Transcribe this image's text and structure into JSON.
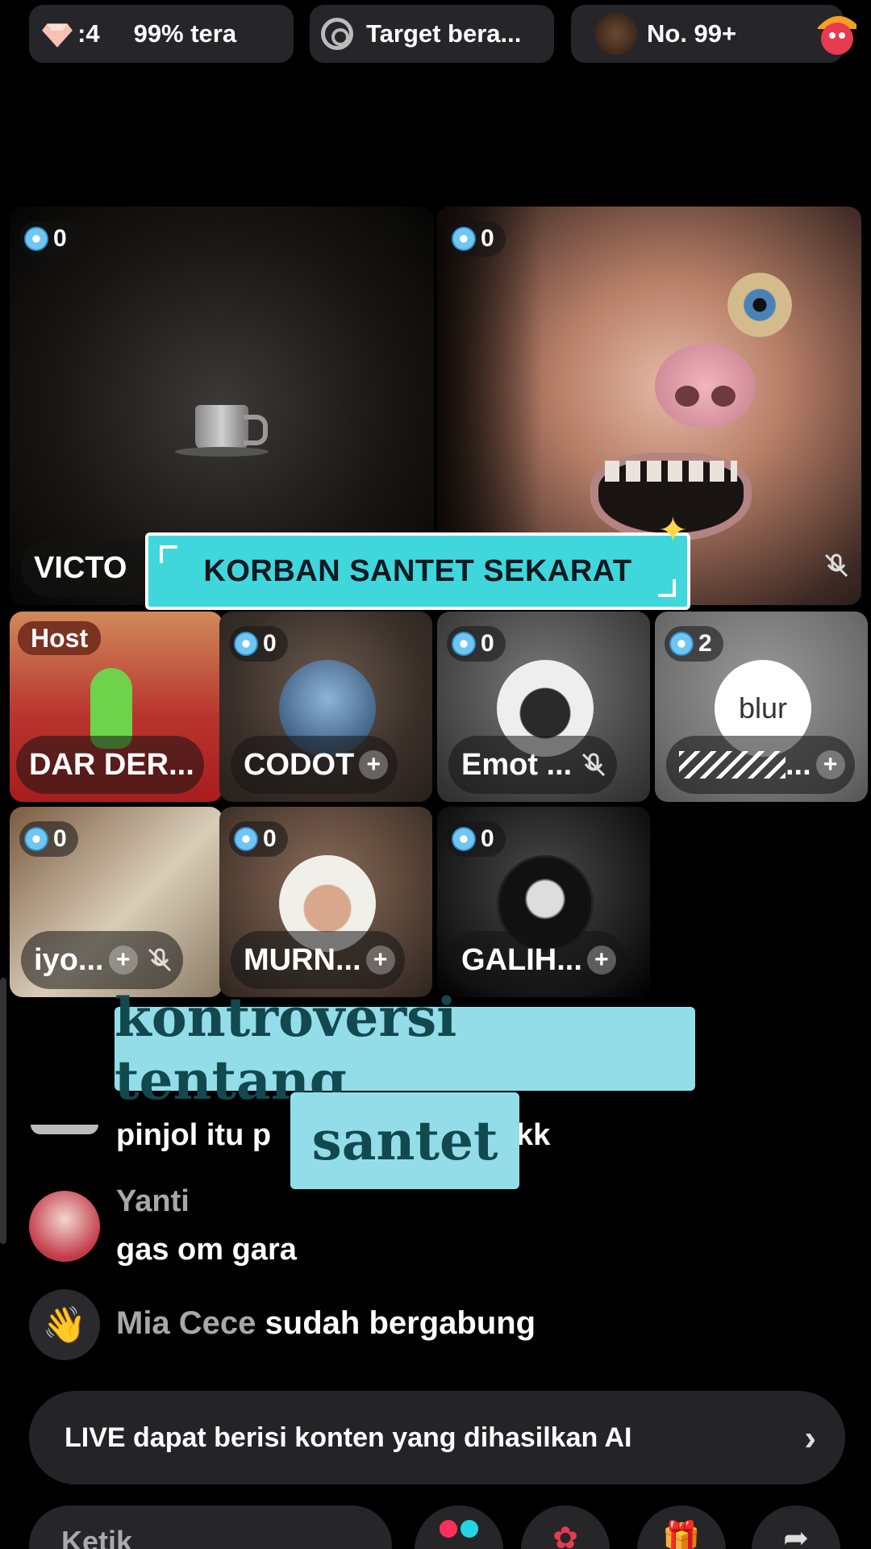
{
  "top_bar": {
    "gem_count": ":4",
    "rank_percent": "99% tera",
    "target": "Target bera...",
    "rank_number": "No. 99+"
  },
  "main_tiles": [
    {
      "gift_count": "0",
      "name": "VICTO"
    },
    {
      "gift_count": "0",
      "name": ""
    }
  ],
  "caption_banner": "KORBAN SANTET SEKARAT",
  "guest_tiles": [
    {
      "tag": "Host",
      "name": "DAR DER..."
    },
    {
      "gift_count": "0",
      "name": "CODOT"
    },
    {
      "gift_count": "0",
      "name": "Emot ..."
    },
    {
      "gift_count": "2",
      "avatar_text": "blur",
      "name": "..."
    },
    {
      "gift_count": "0",
      "name": "iyo..."
    },
    {
      "gift_count": "0",
      "name": "MURN..."
    },
    {
      "gift_count": "0",
      "name": "GALIH..."
    }
  ],
  "subtitle": {
    "line1": "kontroversi tentang",
    "line2": "santet"
  },
  "chat": [
    {
      "text_left": "pinjol itu p",
      "text_right": "kk"
    },
    {
      "username": "Yanti",
      "text": "gas om gara"
    }
  ],
  "join_notice": {
    "username": "Mia Cece",
    "text": "sudah bergabung"
  },
  "ai_notice": "LIVE dapat berisi konten yang dihasilkan AI",
  "input": {
    "placeholder": "Ketik"
  },
  "colors": {
    "caption_bg": "#3fd7dc",
    "subtitle_bg": "#93dde8",
    "subtitle_text": "#11494f"
  }
}
